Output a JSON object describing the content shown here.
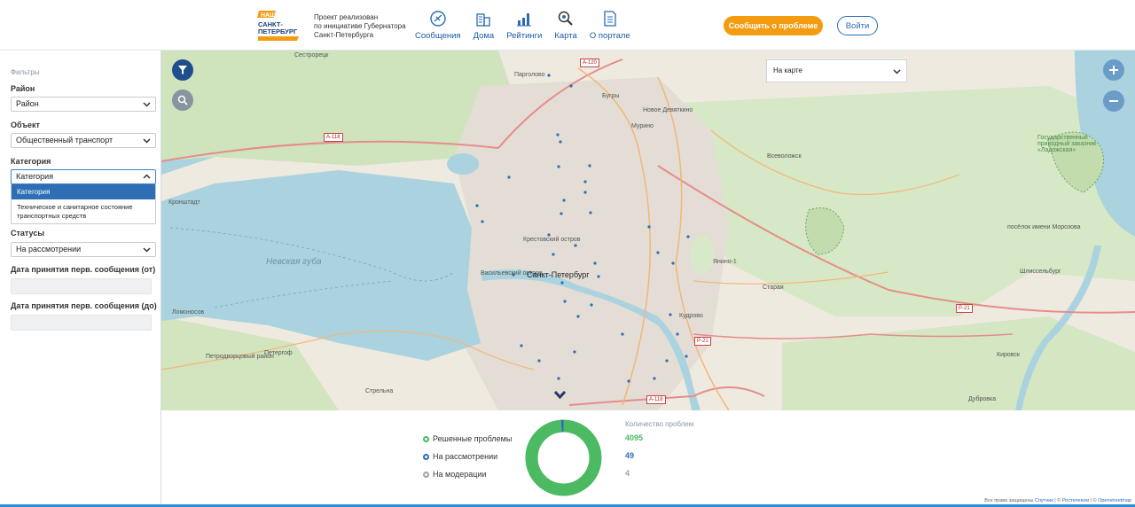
{
  "header": {
    "logo_alt": "НАШ САНКТ-ПЕТЕРБУРГ",
    "tagline": [
      "Проект реализован",
      "по инициативе Губернатора",
      "Санкт-Петербурга"
    ],
    "nav": [
      {
        "label": "Сообщения",
        "icon": "messages-icon"
      },
      {
        "label": "Дома",
        "icon": "buildings-icon"
      },
      {
        "label": "Рейтинги",
        "icon": "ratings-icon"
      },
      {
        "label": "Карта",
        "icon": "map-search-icon"
      },
      {
        "label": "О портале",
        "icon": "document-icon"
      }
    ],
    "report_button": "Сообщить о проблеме",
    "login_button": "Войти"
  },
  "filters": {
    "title": "Фильтры",
    "district_label": "Район",
    "district_value": "Район",
    "object_label": "Объект",
    "object_value": "Общественный транспорт",
    "category_label": "Категория",
    "category_value": "Категория",
    "category_options": [
      "Категория",
      "Техническое и санитарное состояние транспортных средств"
    ],
    "status_label": "Статусы",
    "status_value": "На рассмотрении",
    "date_from_label": "Дата принятия перв. сообщения (от)",
    "date_to_label": "Дата принятия перв. сообщения (до)"
  },
  "map": {
    "view_select": "На карте",
    "labels": {
      "gulf": "Невская губа",
      "city": "Санкт-Петербург",
      "sestroretsk": "Сестрорецк",
      "pargolovo": "Парголово",
      "bugry": "Бугры",
      "devyatkino": "Новое Девяткино",
      "murino": "Мурино",
      "vsevolozhsky": "Всеволожск",
      "kronshtadt": "Кронштадт",
      "lomonosov": "Ломоносов",
      "petergof": "Петергоф",
      "strelna": "Стрельна",
      "kudrovo": "Кудрово",
      "yanino": "Янино-1",
      "staraya": "Старая",
      "morozova": "посёлок имени Морозова",
      "shlisselburg": "Шлиссельбург",
      "kirovsk": "Кировск",
      "dubrovka": "Дубровка",
      "vasilievsky": "Васильевский остров",
      "krestovsky": "Крестовский остров",
      "reserve": "Государственный природный заказник «Ладожская»",
      "petrodvorets": "Петродворцовый район"
    },
    "roads": [
      "А-118",
      "А-118",
      "А-118",
      "Р-21",
      "Р-21",
      "А-120"
    ]
  },
  "stats": {
    "legend": [
      {
        "label": "Решенные проблемы",
        "color": "#4cb963"
      },
      {
        "label": "На рассмотрении",
        "color": "#2e6eb5"
      },
      {
        "label": "На модерации",
        "color": "#9aa3ad"
      }
    ],
    "count_title": "Количество проблем",
    "counts": [
      "4095",
      "49",
      "4"
    ],
    "count_colors": [
      "#4cb963",
      "#2e6eb5",
      "#9aa3ad"
    ],
    "counts_numeric": [
      4095,
      49,
      4
    ]
  },
  "footer": {
    "text": "Все права защищены",
    "link1": "Спутник",
    "link2": "Ростелеком",
    "link3": "Openstreetmap"
  }
}
